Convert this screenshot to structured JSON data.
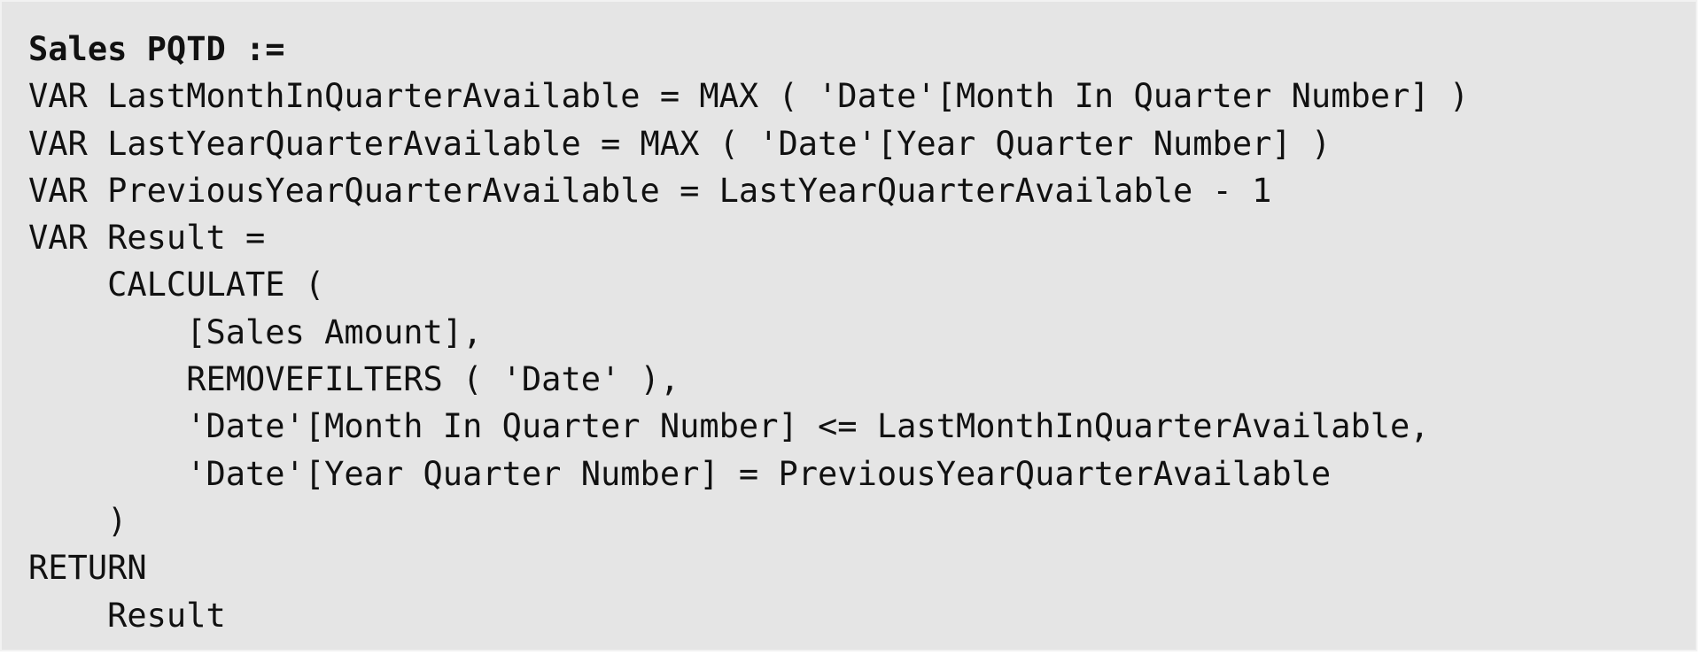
{
  "code": {
    "lines": [
      "Sales PQTD :=",
      "VAR LastMonthInQuarterAvailable = MAX ( 'Date'[Month In Quarter Number] )",
      "VAR LastYearQuarterAvailable = MAX ( 'Date'[Year Quarter Number] )",
      "VAR PreviousYearQuarterAvailable = LastYearQuarterAvailable - 1",
      "VAR Result =",
      "    CALCULATE (",
      "        [Sales Amount],",
      "        REMOVEFILTERS ( 'Date' ),",
      "        'Date'[Month In Quarter Number] <= LastMonthInQuarterAvailable,",
      "        'Date'[Year Quarter Number] = PreviousYearQuarterAvailable",
      "    )",
      "RETURN",
      "    Result"
    ]
  }
}
